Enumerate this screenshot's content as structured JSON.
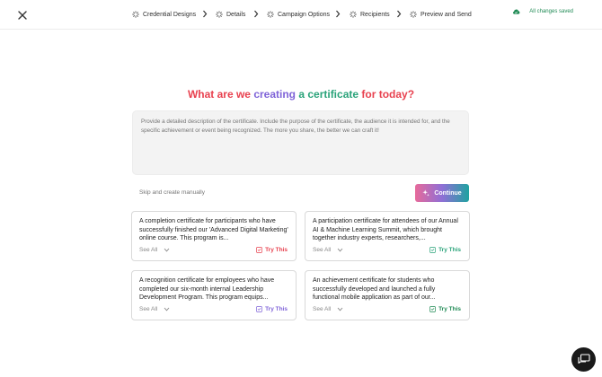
{
  "header": {
    "steps": [
      {
        "label": "Credential Designs"
      },
      {
        "label": "Details"
      },
      {
        "label": "Campaign Options"
      },
      {
        "label": "Recipients"
      },
      {
        "label": "Preview and Send"
      }
    ],
    "save_status": "All changes saved"
  },
  "main": {
    "headline": {
      "part1": "What are we ",
      "part2": "creating",
      "part3": " a certificate",
      "part4": " for today?"
    },
    "prompt_placeholder": "Provide a detailed description of the certificate. Include the purpose of the certificate, the audience it is intended for, and the specific achievement or event being recognized. The more you share, the better we can craft it!",
    "skip_label": "Skip and create manually",
    "continue_label": "Continue"
  },
  "suggestions": [
    {
      "text": "A completion certificate for participants who have successfully finished our 'Advanced Digital Marketing' online course. This program is...",
      "see_all": "See All",
      "try_label": "Try This",
      "accent": "#e8414f"
    },
    {
      "text": "A participation certificate for attendees of our Annual AI & Machine Learning Summit, which brought together industry experts, researchers,...",
      "see_all": "See All",
      "try_label": "Try This",
      "accent": "#2aa37a"
    },
    {
      "text": "A recognition certificate for employees who have completed our six-month internal Leadership Development Program. This program equips...",
      "see_all": "See All",
      "try_label": "Try This",
      "accent": "#7f63d8"
    },
    {
      "text": "An achievement certificate for students who successfully developed and launched a fully functional mobile application as part of our...",
      "see_all": "See All",
      "try_label": "Try This",
      "accent": "#1f8a54"
    }
  ],
  "icons": {
    "close": "close-icon",
    "step": "loader-icon",
    "chevron": "chevron-right-icon",
    "save": "cloud-check-icon",
    "continue": "sparkle-icon",
    "chat": "chat-icon"
  }
}
